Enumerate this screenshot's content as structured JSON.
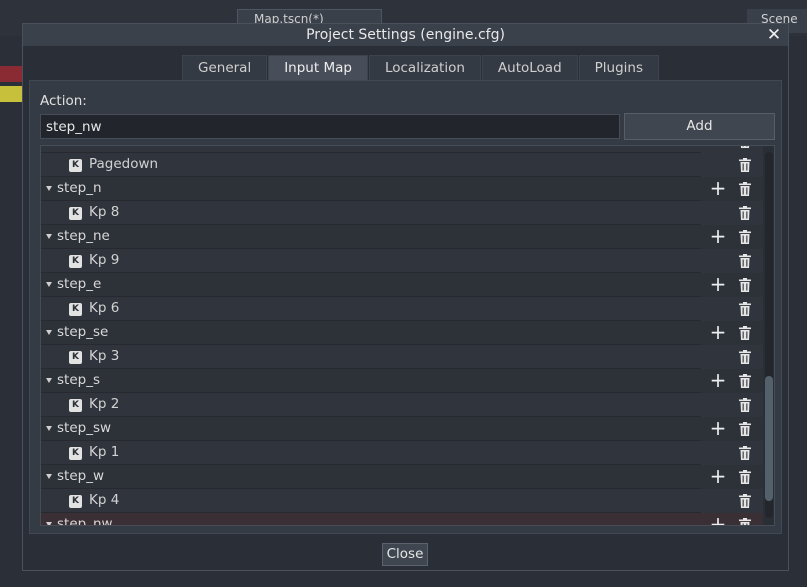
{
  "background": {
    "scene_tab": "Map.tscn(*)",
    "scene_button": "Scene"
  },
  "dialog": {
    "title": "Project Settings (engine.cfg)",
    "close_glyph": "✕",
    "tabs": [
      "General",
      "Input Map",
      "Localization",
      "AutoLoad",
      "Plugins"
    ],
    "active_tab": "Input Map",
    "action_label": "Action:",
    "action_value": "step_nw",
    "add_label": "Add",
    "close_label": "Close"
  },
  "input_map": {
    "rows": [
      {
        "type": "event",
        "text": "Pagedown"
      },
      {
        "type": "action",
        "text": "step_n"
      },
      {
        "type": "event",
        "text": "Kp 8"
      },
      {
        "type": "action",
        "text": "step_ne"
      },
      {
        "type": "event",
        "text": "Kp 9"
      },
      {
        "type": "action",
        "text": "step_e"
      },
      {
        "type": "event",
        "text": "Kp 6"
      },
      {
        "type": "action",
        "text": "step_se"
      },
      {
        "type": "event",
        "text": "Kp 3"
      },
      {
        "type": "action",
        "text": "step_s"
      },
      {
        "type": "event",
        "text": "Kp 2"
      },
      {
        "type": "action",
        "text": "step_sw"
      },
      {
        "type": "event",
        "text": "Kp 1"
      },
      {
        "type": "action",
        "text": "step_w"
      },
      {
        "type": "event",
        "text": "Kp 4"
      },
      {
        "type": "action",
        "text": "step_nw"
      }
    ],
    "key_icon_glyph": "K",
    "add_glyph": "+"
  }
}
